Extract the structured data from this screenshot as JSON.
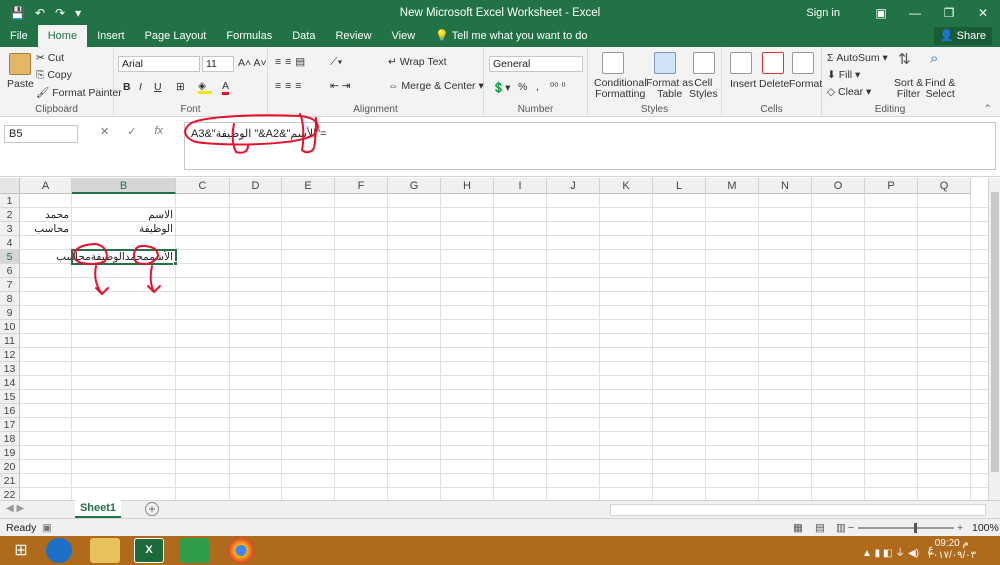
{
  "window": {
    "title": "New Microsoft Excel Worksheet - Excel",
    "signin": "Sign in",
    "qat": [
      "💾",
      "↶",
      "↷",
      "▾"
    ]
  },
  "tabs": [
    "File",
    "Home",
    "Insert",
    "Page Layout",
    "Formulas",
    "Data",
    "Review",
    "View"
  ],
  "tellme": "Tell me what you want to do",
  "share": "Share",
  "ribbon": {
    "clipboard": {
      "label": "Clipboard",
      "paste": "Paste",
      "cut": "Cut",
      "copy": "Copy",
      "format_painter": "Format Painter"
    },
    "font": {
      "label": "Font",
      "name": "Arial",
      "size": "11",
      "bold": "B",
      "italic": "I",
      "underline": "U"
    },
    "alignment": {
      "label": "Alignment",
      "wrap": "Wrap Text",
      "merge": "Merge & Center"
    },
    "number": {
      "label": "Number",
      "format": "General",
      "percent": "%",
      "comma": ","
    },
    "styles": {
      "label": "Styles",
      "conditional": "Conditional",
      "formatting": "Formatting",
      "format_as": "Format as",
      "table": "Table",
      "cell": "Cell",
      "cell_styles": "Styles"
    },
    "cells": {
      "label": "Cells",
      "insert": "Insert",
      "delete": "Delete",
      "format": "Format"
    },
    "editing": {
      "label": "Editing",
      "autosum": "AutoSum",
      "fill": "Fill",
      "clear": "Clear",
      "sort": "Sort &",
      "filter": "Filter",
      "find": "Find &",
      "select": "Select"
    }
  },
  "formula_bar": {
    "name_box": "B5",
    "fx": "fx",
    "formula": "=\"الأسم\"&A2&\" الوظيفة\"&A3"
  },
  "columns": [
    "A",
    "B",
    "C",
    "D",
    "E",
    "F",
    "G",
    "H",
    "I",
    "J",
    "K",
    "L",
    "M",
    "N",
    "O",
    "P",
    "Q"
  ],
  "rows": [
    "1",
    "2",
    "3",
    "4",
    "5",
    "6",
    "7",
    "8",
    "9",
    "10",
    "11",
    "12",
    "13",
    "14",
    "15",
    "16",
    "17",
    "18",
    "19",
    "20",
    "21",
    "22"
  ],
  "cells": {
    "a2": "محمد",
    "b2": "الاسم",
    "a3": "محاسب",
    "b3": "الوظيفة",
    "b5": "الأسممحمدالوظيفةمحاسب"
  },
  "sheet_tab": "Sheet1",
  "status": {
    "ready": "Ready",
    "zoom": "100%"
  },
  "clock": {
    "time": "09:20 م",
    "date": "٢٠١٧/٠٩/٠٣"
  },
  "colors": {
    "accent": "#217346",
    "annotation": "#e8102a",
    "taskbar": "#b06a1b"
  }
}
